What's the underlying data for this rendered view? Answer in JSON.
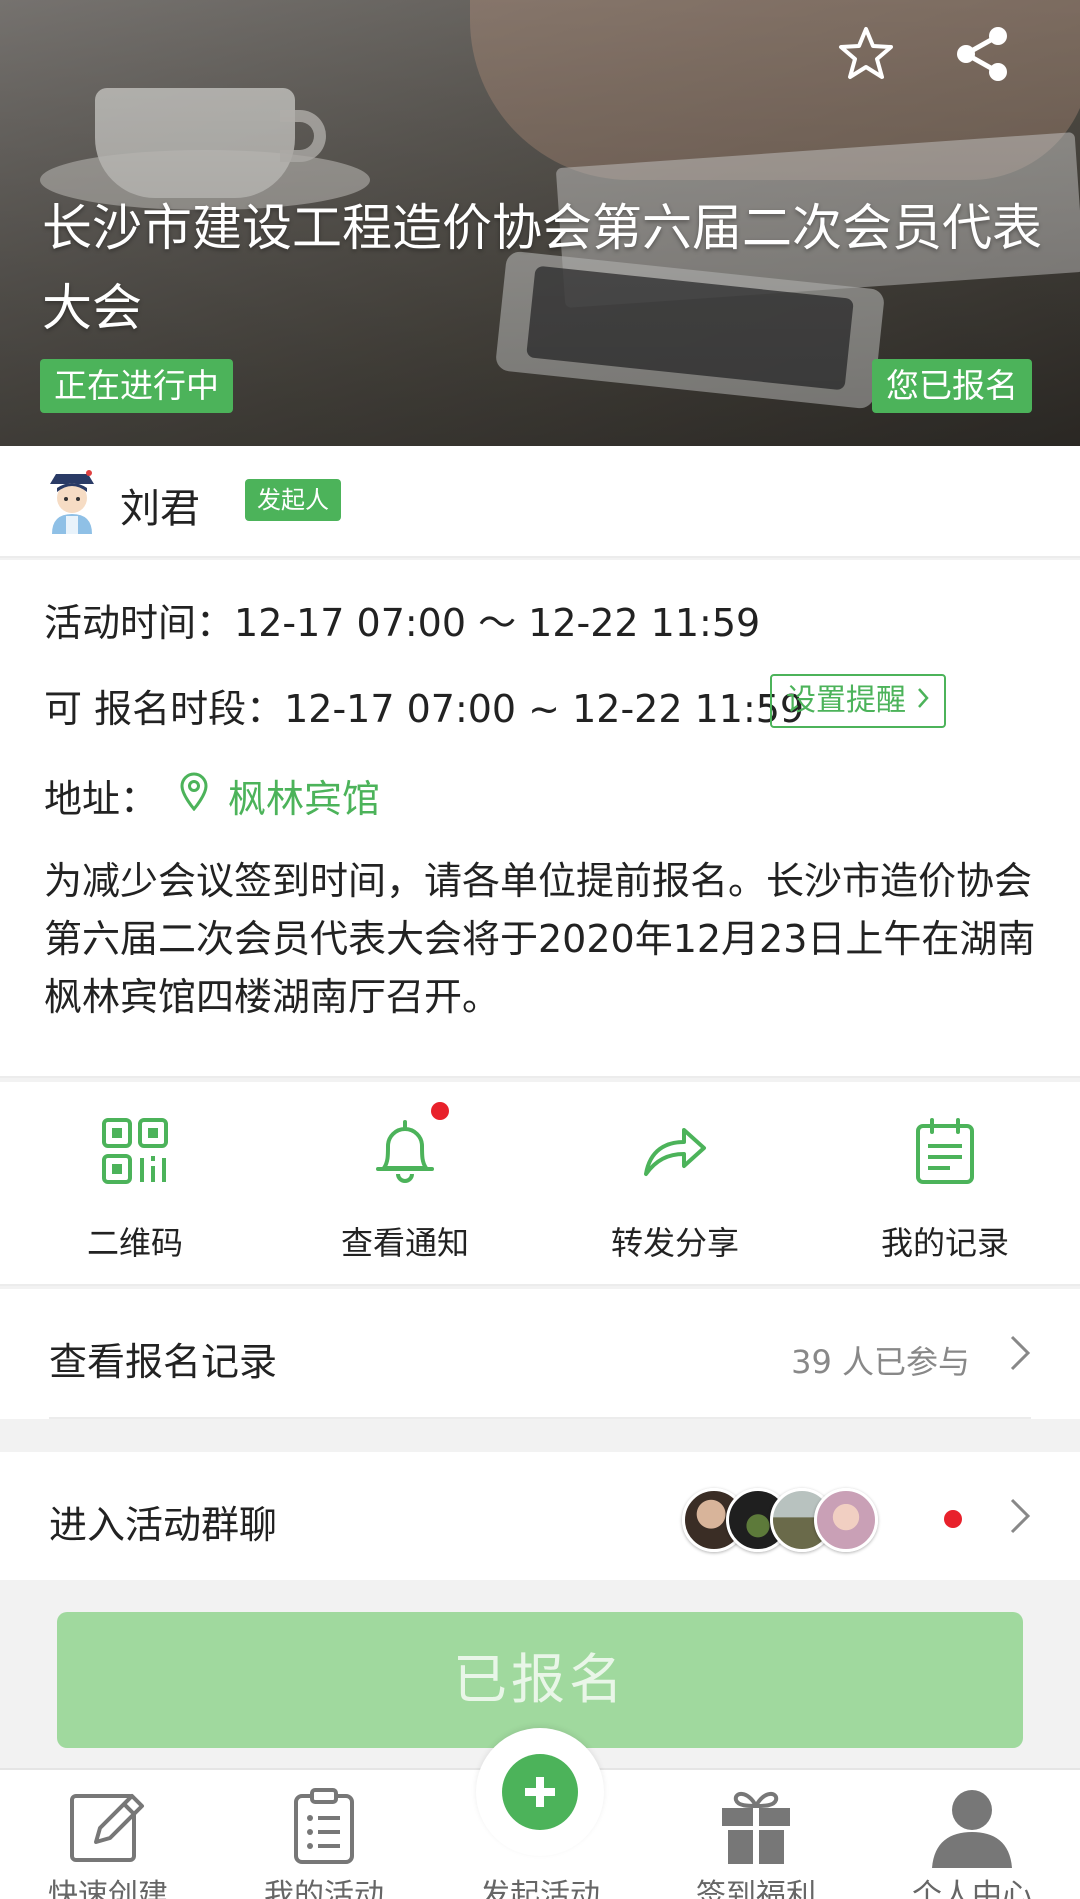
{
  "hero": {
    "title": "长沙市建设工程造价协会第六届二次会员代表大会",
    "status_badge": "正在进行中",
    "registered_badge": "您已报名"
  },
  "initiator": {
    "name": "刘君",
    "role_badge": "发起人"
  },
  "info": {
    "time_label": "活动时间：",
    "time_value": "12-17 07:00 ～ 12-22 11:59",
    "signup_label": "可 报名时段：",
    "signup_value": "12-17 07:00 ~ 12-22 11:59",
    "remind_button": "设置提醒",
    "address_label": "地址：",
    "address_value": "枫林宾馆",
    "description": "为减少会议签到时间，请各单位提前报名。长沙市造价协会第六届二次会员代表大会将于2020年12月23日上午在湖南枫林宾馆四楼湖南厅召开。"
  },
  "actions": [
    {
      "label": "二维码",
      "icon": "qr-code-icon"
    },
    {
      "label": "查看通知",
      "icon": "bell-icon"
    },
    {
      "label": "转发分享",
      "icon": "forward-icon"
    },
    {
      "label": "我的记录",
      "icon": "notepad-icon"
    }
  ],
  "records": {
    "label": "查看报名记录",
    "count": "39 人已参与"
  },
  "chat": {
    "label": "进入活动群聊"
  },
  "main_button": "已报名",
  "nav": [
    {
      "label": "快速创建",
      "icon": "edit-icon"
    },
    {
      "label": "我的活动",
      "icon": "clipboard-icon"
    },
    {
      "label": "发起活动",
      "icon": "plus-icon"
    },
    {
      "label": "签到福利",
      "icon": "gift-icon"
    },
    {
      "label": "个人中心",
      "icon": "user-icon"
    }
  ],
  "colors": {
    "accent": "#4cb35a",
    "disabled_button": "#a0d99e",
    "notification_dot": "#e8212b"
  }
}
